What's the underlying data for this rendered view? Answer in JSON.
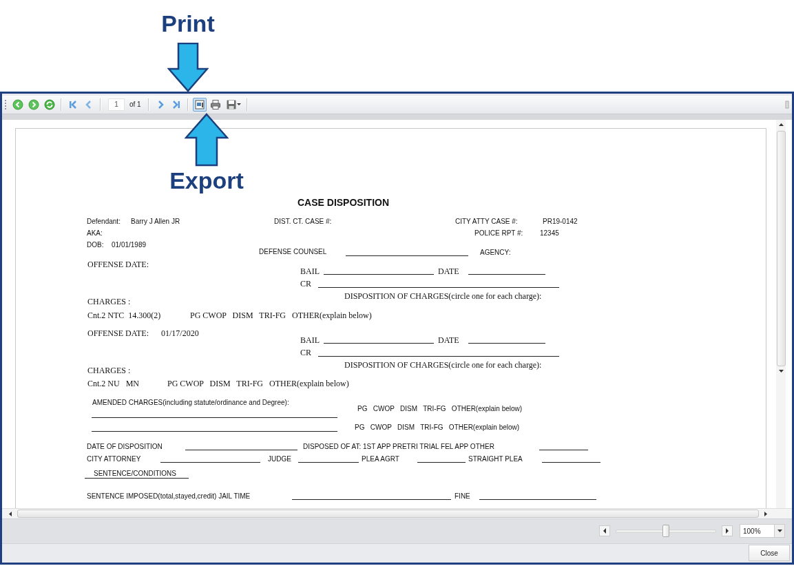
{
  "annotations": [
    {
      "kind": "down",
      "label": "Print"
    },
    {
      "kind": "up",
      "label": "Export"
    }
  ],
  "toolbar": {
    "tools": [
      {
        "kind": "back",
        "pressed": false
      },
      {
        "kind": "forward",
        "pressed": false
      },
      {
        "kind": "refresh",
        "pressed": false
      },
      {
        "kind": "first",
        "pressed": false
      },
      {
        "kind": "prev",
        "pressed": false
      },
      {
        "kind": "page",
        "value": "1",
        "count": "of 1"
      },
      {
        "kind": "next",
        "pressed": false
      },
      {
        "kind": "last",
        "pressed": false
      },
      {
        "kind": "layout",
        "pressed": true
      },
      {
        "kind": "print",
        "pressed": false
      },
      {
        "kind": "export",
        "pressed": false
      }
    ]
  },
  "report": {
    "items": [
      {
        "kind": "title",
        "text": "CASE DISPOSITION"
      },
      {
        "kind": "label",
        "text": "Defendant:"
      },
      {
        "kind": "label",
        "text": "Barry J Allen JR"
      },
      {
        "kind": "label",
        "text": "DIST. CT. CASE #:"
      },
      {
        "kind": "label",
        "text": "CITY ATTY CASE #:"
      },
      {
        "kind": "label",
        "text": "PR19-0142"
      },
      {
        "kind": "label",
        "text": "AKA:"
      },
      {
        "kind": "label",
        "text": "POLICE RPT #:"
      },
      {
        "kind": "label",
        "text": "12345"
      },
      {
        "kind": "label",
        "text": "DOB:"
      },
      {
        "kind": "label",
        "text": "01/01/1989"
      },
      {
        "kind": "label",
        "text": "DEFENSE COUNSEL"
      },
      {
        "kind": "blank"
      },
      {
        "kind": "label",
        "text": "AGENCY:"
      },
      {
        "kind": "print",
        "text": "OFFENSE DATE:"
      },
      {
        "kind": "print",
        "text": "BAIL"
      },
      {
        "kind": "blank"
      },
      {
        "kind": "print",
        "text": "DATE"
      },
      {
        "kind": "blank"
      },
      {
        "kind": "print",
        "text": "CR"
      },
      {
        "kind": "blank"
      },
      {
        "kind": "print",
        "text": "DISPOSITION OF CHARGES(circle one for each charge):"
      },
      {
        "kind": "print",
        "text": "CHARGES :"
      },
      {
        "kind": "print",
        "text": "Cnt.2 NTC  14.300(2)"
      },
      {
        "kind": "print",
        "text": "PG CWOP   DISM   TRI-FG   OTHER(explain below)"
      },
      {
        "kind": "print",
        "text": "OFFENSE DATE:"
      },
      {
        "kind": "print",
        "text": "01/17/2020"
      },
      {
        "kind": "print",
        "text": "BAIL"
      },
      {
        "kind": "blank"
      },
      {
        "kind": "print",
        "text": "DATE"
      },
      {
        "kind": "blank"
      },
      {
        "kind": "print",
        "text": "CR"
      },
      {
        "kind": "blank"
      },
      {
        "kind": "print",
        "text": "DISPOSITION OF CHARGES(circle one for each charge):"
      },
      {
        "kind": "print",
        "text": "CHARGES :"
      },
      {
        "kind": "print",
        "text": "Cnt.2 NU   MN"
      },
      {
        "kind": "print",
        "text": "PG CWOP   DISM   TRI-FG   OTHER(explain below)"
      },
      {
        "kind": "label",
        "text": "AMENDED CHARGES(including statute/ordinance and Degree):"
      },
      {
        "kind": "label",
        "text": "PG   CWOP   DISM   TRI-FG   OTHER(explain below)"
      },
      {
        "kind": "blank"
      },
      {
        "kind": "label",
        "text": "PG   CWOP   DISM   TRI-FG   OTHER(explain below)"
      },
      {
        "kind": "blank"
      },
      {
        "kind": "label",
        "text": "DATE OF DISPOSITION"
      },
      {
        "kind": "blank"
      },
      {
        "kind": "label",
        "text": "DISPOSED OF AT: 1ST APP PRETRI TRIAL FEL APP OTHER"
      },
      {
        "kind": "blank"
      },
      {
        "kind": "label",
        "text": "CITY ATTORNEY"
      },
      {
        "kind": "blank"
      },
      {
        "kind": "label",
        "text": "JUDGE"
      },
      {
        "kind": "blank"
      },
      {
        "kind": "label",
        "text": "PLEA AGRT"
      },
      {
        "kind": "blank"
      },
      {
        "kind": "label",
        "text": "STRAIGHT PLEA"
      },
      {
        "kind": "blank"
      },
      {
        "kind": "label",
        "text": "SENTENCE/CONDITIONS"
      },
      {
        "kind": "blank"
      },
      {
        "kind": "label",
        "text": "SENTENCE IMPOSED(total,stayed,credit) JAIL TIME"
      },
      {
        "kind": "blank"
      },
      {
        "kind": "label",
        "text": "FINE"
      },
      {
        "kind": "blank"
      }
    ]
  },
  "zoom": {
    "level": 0.49,
    "value": "100%"
  },
  "buttons": [
    "Close"
  ]
}
